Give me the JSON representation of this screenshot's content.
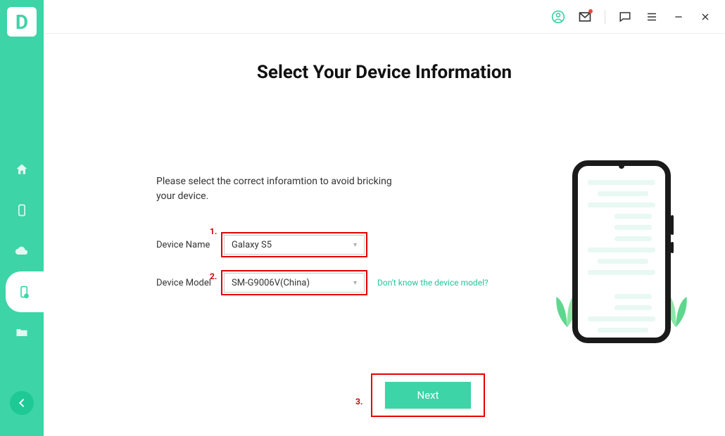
{
  "app": {
    "logo_letter": "D"
  },
  "titlebar": {
    "icons": [
      "account",
      "mail",
      "feedback",
      "menu",
      "minimize",
      "close"
    ]
  },
  "page": {
    "title": "Select Your Device Information",
    "instruction": "Please select the correct inforamtion to avoid bricking your device."
  },
  "form": {
    "device_name": {
      "label": "Device Name",
      "value": "Galaxy S5"
    },
    "device_model": {
      "label": "Device Model",
      "value": "SM-G9006V(China)",
      "help": "Don't know the device model?"
    }
  },
  "annotations": {
    "one": "1.",
    "two": "2.",
    "three": "3."
  },
  "actions": {
    "next": "Next"
  }
}
